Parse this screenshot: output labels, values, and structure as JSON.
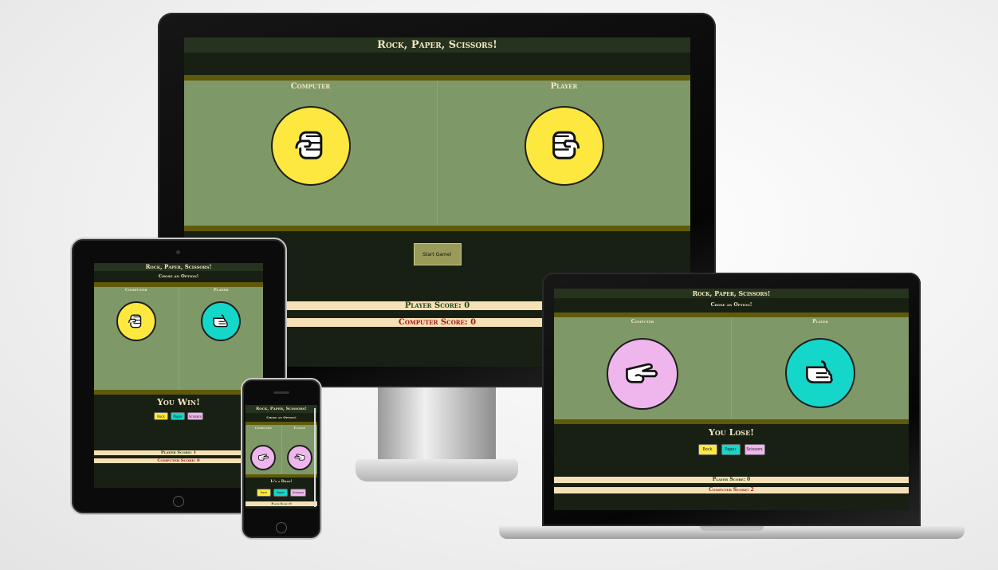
{
  "title": "Rock, Paper, Scissors!",
  "subtitle": "Chose an Option!",
  "labels": {
    "computer": "Computer",
    "player": "Player"
  },
  "buttons": {
    "rock": "Rock",
    "paper": "Paper",
    "scissors": "Scissors",
    "start": "Start Game!"
  },
  "colors": {
    "rock": "#fde83f",
    "paper": "#14d6c9",
    "scissors": "#efb6ee",
    "field": "#7f9867",
    "dark": "#182014",
    "olive": "#5f5a0a",
    "score_bg": "#f6e0b5"
  },
  "desktop": {
    "computer_hand": "rock-fist-icon",
    "player_hand": "rock-fist-icon",
    "player_score": "Player Score: 0",
    "computer_score": "Computer Score: 0"
  },
  "tablet": {
    "computer_hand": "rock-fist-icon",
    "player_hand": "paper-hand-icon",
    "result": "You Win!",
    "player_score": "Player Score: 1",
    "computer_score": "Computer Score: 0"
  },
  "phone": {
    "computer_hand": "scissors-hand-icon",
    "player_hand": "scissors-hand-icon",
    "result": "It's a Draw!",
    "player_score": "Player Score: 0"
  },
  "laptop": {
    "computer_hand": "scissors-hand-icon",
    "player_hand": "paper-hand-icon",
    "result": "You Lose!",
    "player_score": "Player Score: 0",
    "computer_score": "Computer Score: 2"
  }
}
